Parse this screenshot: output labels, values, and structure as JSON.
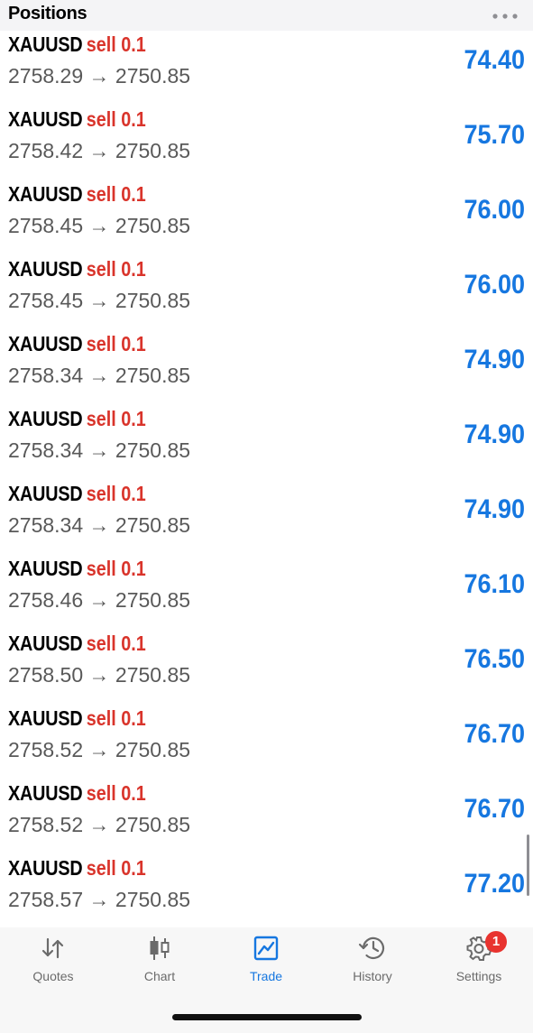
{
  "header": {
    "title": "Positions",
    "more_icon": "more-horizontal-icon"
  },
  "positions": [
    {
      "symbol": "XAUUSD",
      "type": "sell 0.1",
      "open": "2758.29",
      "arrow": "→",
      "current": "2750.85",
      "profit": "74.40"
    },
    {
      "symbol": "XAUUSD",
      "type": "sell 0.1",
      "open": "2758.42",
      "arrow": "→",
      "current": "2750.85",
      "profit": "75.70"
    },
    {
      "symbol": "XAUUSD",
      "type": "sell 0.1",
      "open": "2758.45",
      "arrow": "→",
      "current": "2750.85",
      "profit": "76.00"
    },
    {
      "symbol": "XAUUSD",
      "type": "sell 0.1",
      "open": "2758.45",
      "arrow": "→",
      "current": "2750.85",
      "profit": "76.00"
    },
    {
      "symbol": "XAUUSD",
      "type": "sell 0.1",
      "open": "2758.34",
      "arrow": "→",
      "current": "2750.85",
      "profit": "74.90"
    },
    {
      "symbol": "XAUUSD",
      "type": "sell 0.1",
      "open": "2758.34",
      "arrow": "→",
      "current": "2750.85",
      "profit": "74.90"
    },
    {
      "symbol": "XAUUSD",
      "type": "sell 0.1",
      "open": "2758.34",
      "arrow": "→",
      "current": "2750.85",
      "profit": "74.90"
    },
    {
      "symbol": "XAUUSD",
      "type": "sell 0.1",
      "open": "2758.46",
      "arrow": "→",
      "current": "2750.85",
      "profit": "76.10"
    },
    {
      "symbol": "XAUUSD",
      "type": "sell 0.1",
      "open": "2758.50",
      "arrow": "→",
      "current": "2750.85",
      "profit": "76.50"
    },
    {
      "symbol": "XAUUSD",
      "type": "sell 0.1",
      "open": "2758.52",
      "arrow": "→",
      "current": "2750.85",
      "profit": "76.70"
    },
    {
      "symbol": "XAUUSD",
      "type": "sell 0.1",
      "open": "2758.52",
      "arrow": "→",
      "current": "2750.85",
      "profit": "76.70"
    },
    {
      "symbol": "XAUUSD",
      "type": "sell 0.1",
      "open": "2758.57",
      "arrow": "→",
      "current": "2750.85",
      "profit": "77.20"
    }
  ],
  "tabs": [
    {
      "label": "Quotes",
      "icon": "quotes-arrows-icon"
    },
    {
      "label": "Chart",
      "icon": "candlestick-chart-icon"
    },
    {
      "label": "Trade",
      "icon": "trade-chart-icon",
      "active": true
    },
    {
      "label": "History",
      "icon": "history-clock-icon"
    },
    {
      "label": "Settings",
      "icon": "gear-icon",
      "badge": "1"
    }
  ],
  "colors": {
    "accent": "#1677e0",
    "sell": "#d9342b",
    "badge": "#e8332f",
    "header_bg": "#f4f4f6",
    "tabbar_bg": "#f7f7f7"
  }
}
